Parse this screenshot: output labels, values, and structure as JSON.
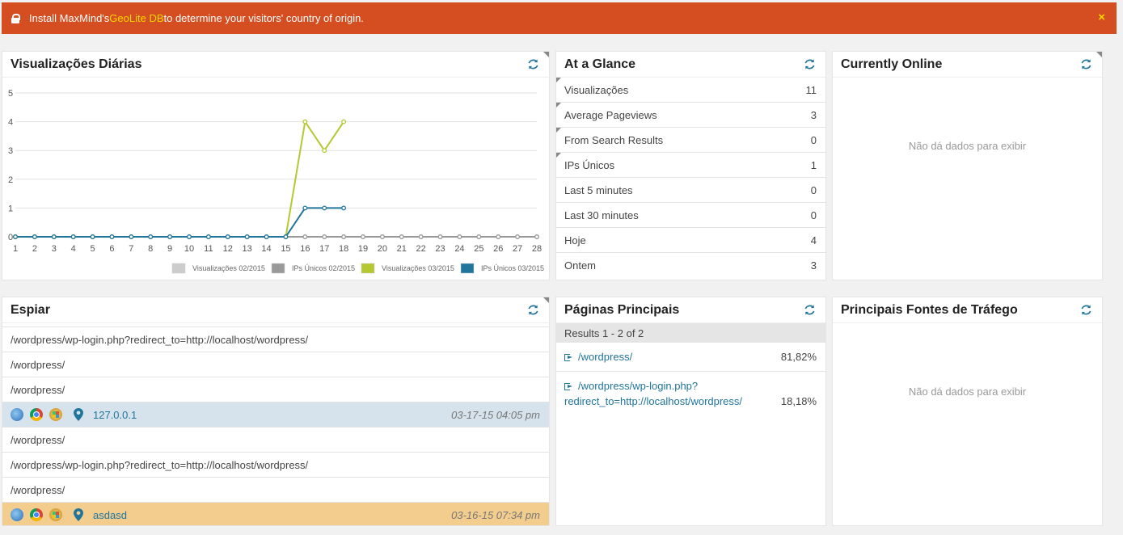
{
  "notice": {
    "prefix": "Install MaxMind's ",
    "link": "GeoLite DB",
    "suffix": " to determine your visitors' country of origin.",
    "close": "×"
  },
  "daily": {
    "title": "Visualizações Diárias",
    "chart_data": {
      "type": "line",
      "x": [
        1,
        2,
        3,
        4,
        5,
        6,
        7,
        8,
        9,
        10,
        11,
        12,
        13,
        14,
        15,
        16,
        17,
        18,
        19,
        20,
        21,
        22,
        23,
        24,
        25,
        26,
        27,
        28
      ],
      "ylim": [
        0,
        5
      ],
      "yticks": [
        0,
        1,
        2,
        3,
        4,
        5
      ],
      "grid": true,
      "legend_position": "bottom-right",
      "series": [
        {
          "name": "Visualizações 02/2015",
          "color": "#cccccc",
          "values": [
            0,
            0,
            0,
            0,
            0,
            0,
            0,
            0,
            0,
            0,
            0,
            0,
            0,
            0,
            0,
            0,
            0,
            0,
            0,
            0,
            0,
            0,
            0,
            0,
            0,
            0,
            0,
            0
          ]
        },
        {
          "name": "IPs Únicos 02/2015",
          "color": "#999999",
          "values": [
            0,
            0,
            0,
            0,
            0,
            0,
            0,
            0,
            0,
            0,
            0,
            0,
            0,
            0,
            0,
            0,
            0,
            0,
            0,
            0,
            0,
            0,
            0,
            0,
            0,
            0,
            0,
            0
          ]
        },
        {
          "name": "Visualizações 03/2015",
          "color": "#b5c832",
          "values": [
            0,
            0,
            0,
            0,
            0,
            0,
            0,
            0,
            0,
            0,
            0,
            0,
            0,
            0,
            0,
            4,
            3,
            4
          ]
        },
        {
          "name": "IPs Únicos 03/2015",
          "color": "#21759b",
          "values": [
            0,
            0,
            0,
            0,
            0,
            0,
            0,
            0,
            0,
            0,
            0,
            0,
            0,
            0,
            0,
            1,
            1,
            1
          ]
        }
      ]
    }
  },
  "glance": {
    "title": "At a Glance",
    "rows": [
      {
        "label": "Visualizações",
        "value": "11"
      },
      {
        "label": "Average Pageviews",
        "value": "3"
      },
      {
        "label": "From Search Results",
        "value": "0"
      },
      {
        "label": "IPs Únicos",
        "value": "1"
      },
      {
        "label": "Last 5 minutes",
        "value": "0"
      },
      {
        "label": "Last 30 minutes",
        "value": "0"
      },
      {
        "label": "Hoje",
        "value": "4"
      },
      {
        "label": "Ontem",
        "value": "3"
      }
    ]
  },
  "online": {
    "title": "Currently Online",
    "empty": "Não dá dados para exibir"
  },
  "espiar": {
    "title": "Espiar",
    "groups": [
      {
        "pages": [
          "/wordpress/wp-login.php?redirect_to=http://localhost/wordpress/",
          "/wordpress/",
          "/wordpress/"
        ],
        "visitor": "127.0.0.1",
        "time": "03-17-15 04:05 pm"
      },
      {
        "pages": [
          "/wordpress/",
          "/wordpress/wp-login.php?redirect_to=http://localhost/wordpress/",
          "/wordpress/"
        ],
        "visitor": "asdasd",
        "time": "03-16-15 07:34 pm"
      }
    ]
  },
  "pages": {
    "title": "Páginas Principais",
    "results": "Results 1 - 2 of 2",
    "rows": [
      {
        "line1": "/wordpress/",
        "line2": "",
        "pct": "81,82%"
      },
      {
        "line1": "/wordpress/wp-login.php?",
        "line2": "redirect_to=http://localhost/wordpress/",
        "pct": "18,18%"
      }
    ]
  },
  "traffic": {
    "title": "Principais Fontes de Tráfego",
    "empty": "Não dá dados para exibir"
  },
  "icons": {
    "refresh": "refresh-icon",
    "lock": "lock-icon",
    "globe": "globe-icon",
    "chrome": "chrome-icon",
    "windows": "windows-icon",
    "pin": "map-pin-icon",
    "external": "external-link-icon"
  }
}
